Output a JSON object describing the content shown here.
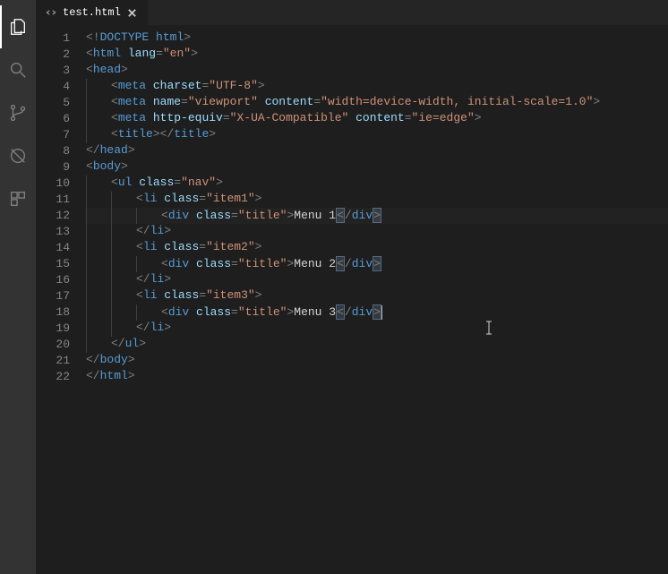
{
  "icons": {
    "explorer": "files-icon",
    "search": "search-icon",
    "scm": "branch-icon",
    "debug": "bug-icon",
    "extensions": "extensions-icon"
  },
  "tab": {
    "filename": "test.html"
  },
  "line_numbers": [
    "1",
    "2",
    "3",
    "4",
    "5",
    "6",
    "7",
    "8",
    "9",
    "10",
    "11",
    "12",
    "13",
    "14",
    "15",
    "16",
    "17",
    "18",
    "19",
    "20",
    "21",
    "22"
  ],
  "code": {
    "l1": {
      "doctype_kw": "DOCTYPE",
      "doctype_arg": "html"
    },
    "l2": {
      "tag": "html",
      "attr": "lang",
      "val": "\"en\""
    },
    "l3": {
      "tag": "head"
    },
    "l4": {
      "tag": "meta",
      "attr": "charset",
      "val": "\"UTF-8\""
    },
    "l5": {
      "tag": "meta",
      "a1": "name",
      "v1": "\"viewport\"",
      "a2": "content",
      "v2": "\"width=device-width, initial-scale=1.0\""
    },
    "l6": {
      "tag": "meta",
      "a1": "http-equiv",
      "v1": "\"X-UA-Compatible\"",
      "a2": "content",
      "v2": "\"ie=edge\""
    },
    "l7": {
      "open": "title",
      "close": "title"
    },
    "l8": {
      "close": "head"
    },
    "l9": {
      "tag": "body"
    },
    "l10": {
      "tag": "ul",
      "attr": "class",
      "val": "\"nav\""
    },
    "l11": {
      "tag": "li",
      "attr": "class",
      "val": "\"item1\""
    },
    "l12": {
      "tag": "div",
      "attr": "class",
      "val": "\"title\"",
      "text": "Menu 1",
      "close": "div"
    },
    "l13": {
      "close": "li"
    },
    "l14": {
      "tag": "li",
      "attr": "class",
      "val": "\"item2\""
    },
    "l15": {
      "tag": "div",
      "attr": "class",
      "val": "\"title\"",
      "text": "Menu 2",
      "close": "div"
    },
    "l16": {
      "close": "li"
    },
    "l17": {
      "tag": "li",
      "attr": "class",
      "val": "\"item3\""
    },
    "l18": {
      "tag": "div",
      "attr": "class",
      "val": "\"title\"",
      "text": "Menu 3",
      "close": "div"
    },
    "l19": {
      "close": "li"
    },
    "l20": {
      "close": "ul"
    },
    "l21": {
      "close": "body"
    },
    "l22": {
      "close": "html"
    }
  }
}
